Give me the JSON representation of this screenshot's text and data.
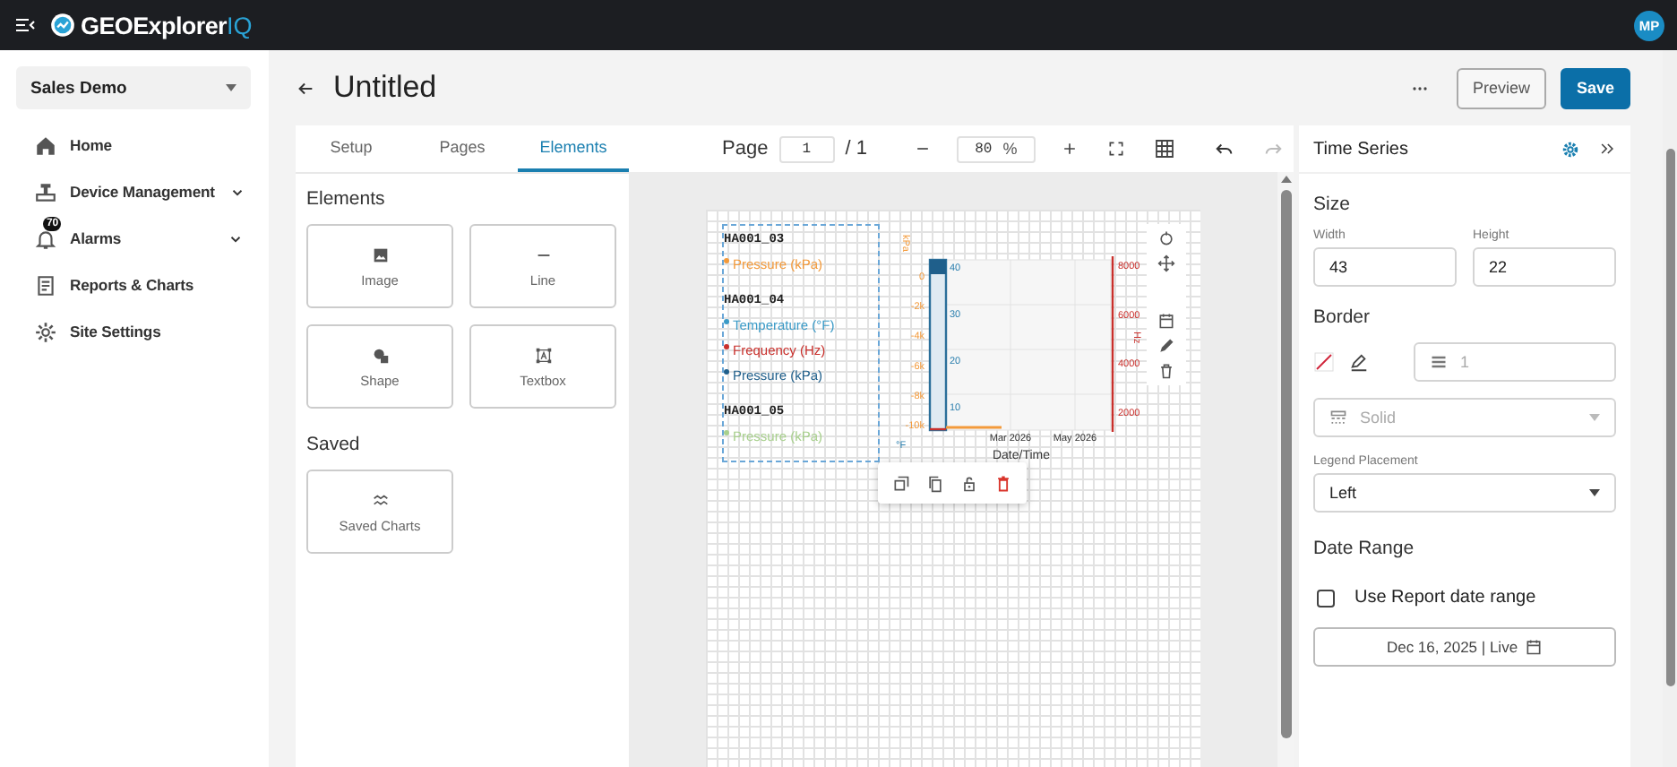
{
  "top_bar": {
    "brand": "GEOExplorer",
    "brand_suffix": "IQ",
    "avatar": "MP"
  },
  "sidebar": {
    "workspace": "Sales Demo",
    "items": [
      {
        "label": "Home",
        "kind": "home",
        "expandable": false
      },
      {
        "label": "Device Management",
        "kind": "device",
        "expandable": true
      },
      {
        "label": "Alarms",
        "kind": "alarm",
        "expandable": true,
        "badge": "70"
      },
      {
        "label": "Reports & Charts",
        "kind": "report",
        "expandable": false
      },
      {
        "label": "Site Settings",
        "kind": "settings",
        "expandable": false
      }
    ]
  },
  "page": {
    "title": "Untitled",
    "actions": [
      {
        "label": "Preview",
        "kind": "secondary"
      },
      {
        "label": "Save",
        "kind": "primary"
      }
    ]
  },
  "builder_tabs": [
    {
      "label": "Setup",
      "selected": false
    },
    {
      "label": "Pages",
      "selected": false
    },
    {
      "label": "Elements",
      "selected": true
    }
  ],
  "elements_panel": {
    "heading": "Elements",
    "tiles": [
      {
        "label": "Image",
        "kind": "image"
      },
      {
        "label": "Line",
        "kind": "line"
      },
      {
        "label": "Shape",
        "kind": "shape"
      },
      {
        "label": "Textbox",
        "kind": "textbox"
      }
    ],
    "saved_heading": "Saved",
    "saved_tiles": [
      {
        "label": "Saved Charts",
        "kind": "charts"
      }
    ]
  },
  "canvas_toolbar": {
    "page_label": "Page",
    "page_value": "1",
    "page_total": "/ 1",
    "zoom_value": "80",
    "zoom_unit": "%",
    "undo": {
      "disabled": false
    },
    "redo": {
      "disabled": true
    }
  },
  "chart_element": {
    "legend": [
      {
        "device": "HA001_03",
        "series": [
          {
            "name": "Pressure (kPa)",
            "color": "#f39a3b"
          }
        ]
      },
      {
        "device": "HA001_04",
        "series": [
          {
            "name": "Temperature (°F)",
            "color": "#3a9ac7"
          },
          {
            "name": "Frequency (Hz)",
            "color": "#c9302c"
          },
          {
            "name": "Pressure (kPa)",
            "color": "#1f5f8b"
          }
        ]
      },
      {
        "device": "HA001_05",
        "series": [
          {
            "name": "Pressure (kPa)",
            "color": "#a8d08d"
          }
        ]
      }
    ],
    "left_axis_title": "kPa",
    "right_axis_title": "Hz",
    "inner_axis_title": "°F",
    "left_ticks": [
      "0",
      "-2k",
      "-4k",
      "-6k",
      "-8k",
      "-10k"
    ],
    "inner_ticks": [
      "40",
      "30",
      "20",
      "10"
    ],
    "right_ticks": [
      "8000",
      "6000",
      "4000",
      "2000"
    ],
    "x_ticks": [
      "Mar 2026",
      "May 2026"
    ],
    "x_title": "Date/Time"
  },
  "properties": {
    "title": "Time Series",
    "size_heading": "Size",
    "width": {
      "label": "Width",
      "value": "43"
    },
    "height": {
      "label": "Height",
      "value": "22"
    },
    "border_heading": "Border",
    "border_width": {
      "value": "1",
      "disabled": true
    },
    "border_style": {
      "value": "Solid",
      "disabled": true
    },
    "legend_placement": {
      "label": "Legend Placement",
      "value": "Left"
    },
    "date_range_heading": "Date Range",
    "use_report_range": {
      "label": "Use Report date range",
      "checked": false
    },
    "date_button": "Dec 16, 2025 | Live"
  }
}
